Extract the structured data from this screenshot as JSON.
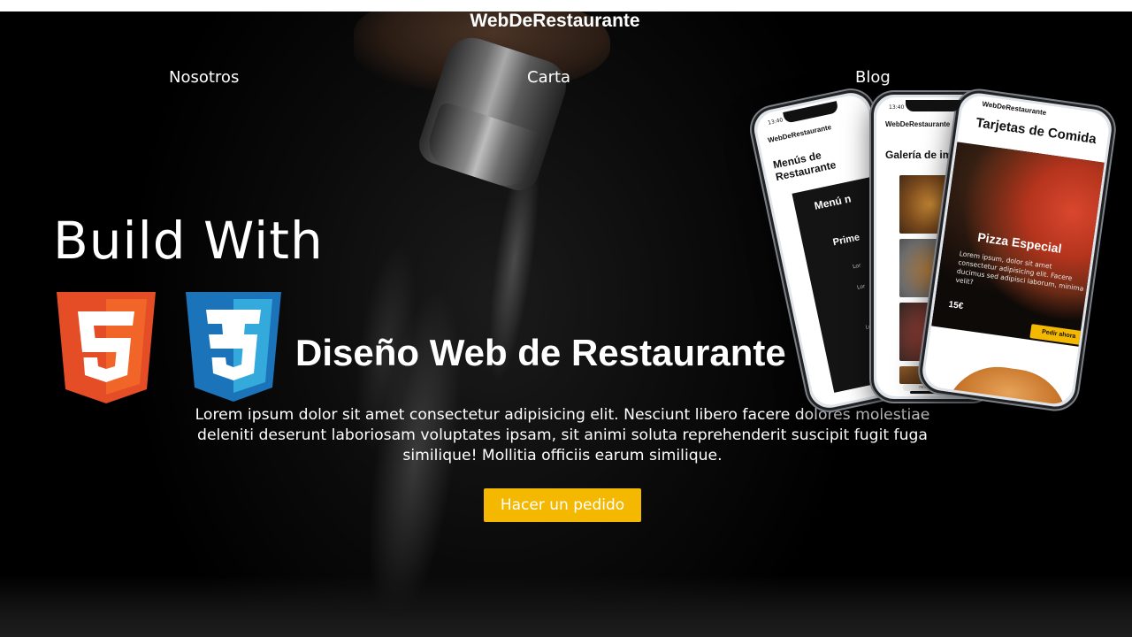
{
  "brand": "WebDeRestaurante",
  "nav": [
    {
      "label": "Nosotros"
    },
    {
      "label": "Carta"
    },
    {
      "label": "Blog"
    }
  ],
  "hero": {
    "build_text": "Build With",
    "title": "Diseño Web de Restaurante",
    "description": "Lorem ipsum dolor sit amet consectetur adipisicing elit. Nesciunt libero facere dolores molestiae deleniti deserunt laboriosam voluptates ipsam, sit animi soluta reprehenderit suscipit fugit fuga similique! Mollitia officiis earum similique.",
    "cta_label": "Hacer un pedido",
    "logos": [
      {
        "icon": "html5-icon",
        "color": "#e44d26",
        "text": "5"
      },
      {
        "icon": "css3-icon",
        "color": "#1b73ba",
        "text": "3"
      }
    ]
  },
  "colors": {
    "accent": "#f5b800",
    "background": "#000000"
  },
  "mockup": {
    "phone1": {
      "time": "13:40",
      "brand": "WebDeRestaurante",
      "heading": "Menús de Restaurante",
      "card_title": "Menú n",
      "card_subtitle": "Prime",
      "lines": [
        "Lor",
        "Lor",
        "Lor"
      ]
    },
    "phone2": {
      "time": "13:40",
      "brand": "WebDeRestaurante",
      "heading": "Galería de im",
      "url": "restaurante.com"
    },
    "phone3": {
      "brand": "WebDeRestaurante",
      "heading": "Tarjetas de Comida",
      "item_name": "Pizza Especial",
      "item_desc": "Lorem ipsum, dolor sit amet consectetur adipisicing elit. Facere ducimus sed adipisci laborum, minima velit?",
      "price": "15€",
      "button": "Pedir ahora"
    }
  }
}
